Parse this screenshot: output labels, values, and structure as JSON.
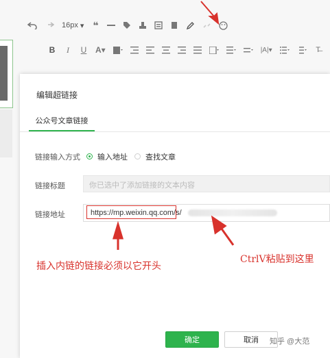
{
  "editor": {
    "font_size": "16px",
    "link_tool_icon": "pencil-link-icon"
  },
  "dialog": {
    "title": "编辑超链接",
    "tab_label": "公众号文章链接",
    "method_label": "链接输入方式",
    "option_input_address": "输入地址",
    "option_search_article": "查找文章",
    "selected_option": "输入地址",
    "link_title_label": "链接标题",
    "link_title_placeholder": "你已选中了添加链接的文本内容",
    "link_address_label": "链接地址",
    "link_address_value": "https://mp.weixin.qq.com/s/",
    "ok_label": "确定",
    "cancel_label": "取消"
  },
  "annotations": {
    "left_note": "插入内链的链接必须以它开头",
    "right_note": "CtrlV粘贴到这里",
    "color": "#d8322c"
  },
  "watermark": "知乎 @大范",
  "colors": {
    "accent_green": "#2eb34d",
    "annotation_red": "#d8322c"
  }
}
